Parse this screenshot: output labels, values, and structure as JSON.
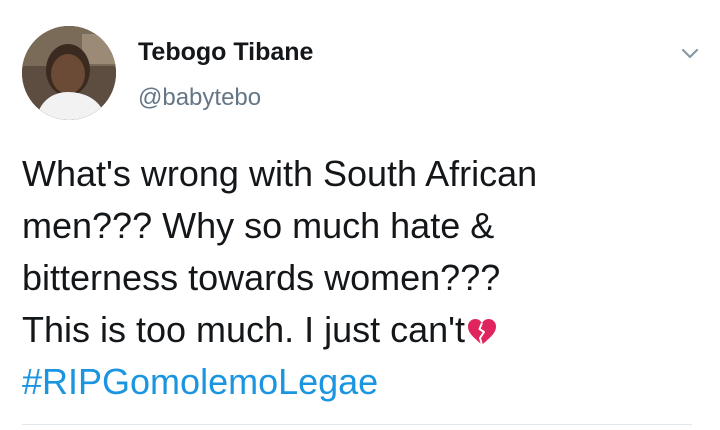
{
  "author": {
    "display_name": "Tebogo Tibane",
    "handle": "@babytebo"
  },
  "tweet": {
    "lines": [
      "What's wrong with South African",
      "men??? Why so much hate &",
      "bitterness towards women???",
      "This is too much. I just can't"
    ],
    "emoji": "broken-heart-icon",
    "hashtag": "#RIPGomolemoLegae"
  },
  "icons": {
    "menu": "chevron-down-icon"
  },
  "colors": {
    "text": "#14171a",
    "secondary": "#657786",
    "link": "#1b95e0",
    "emoji": "#e0245e"
  }
}
